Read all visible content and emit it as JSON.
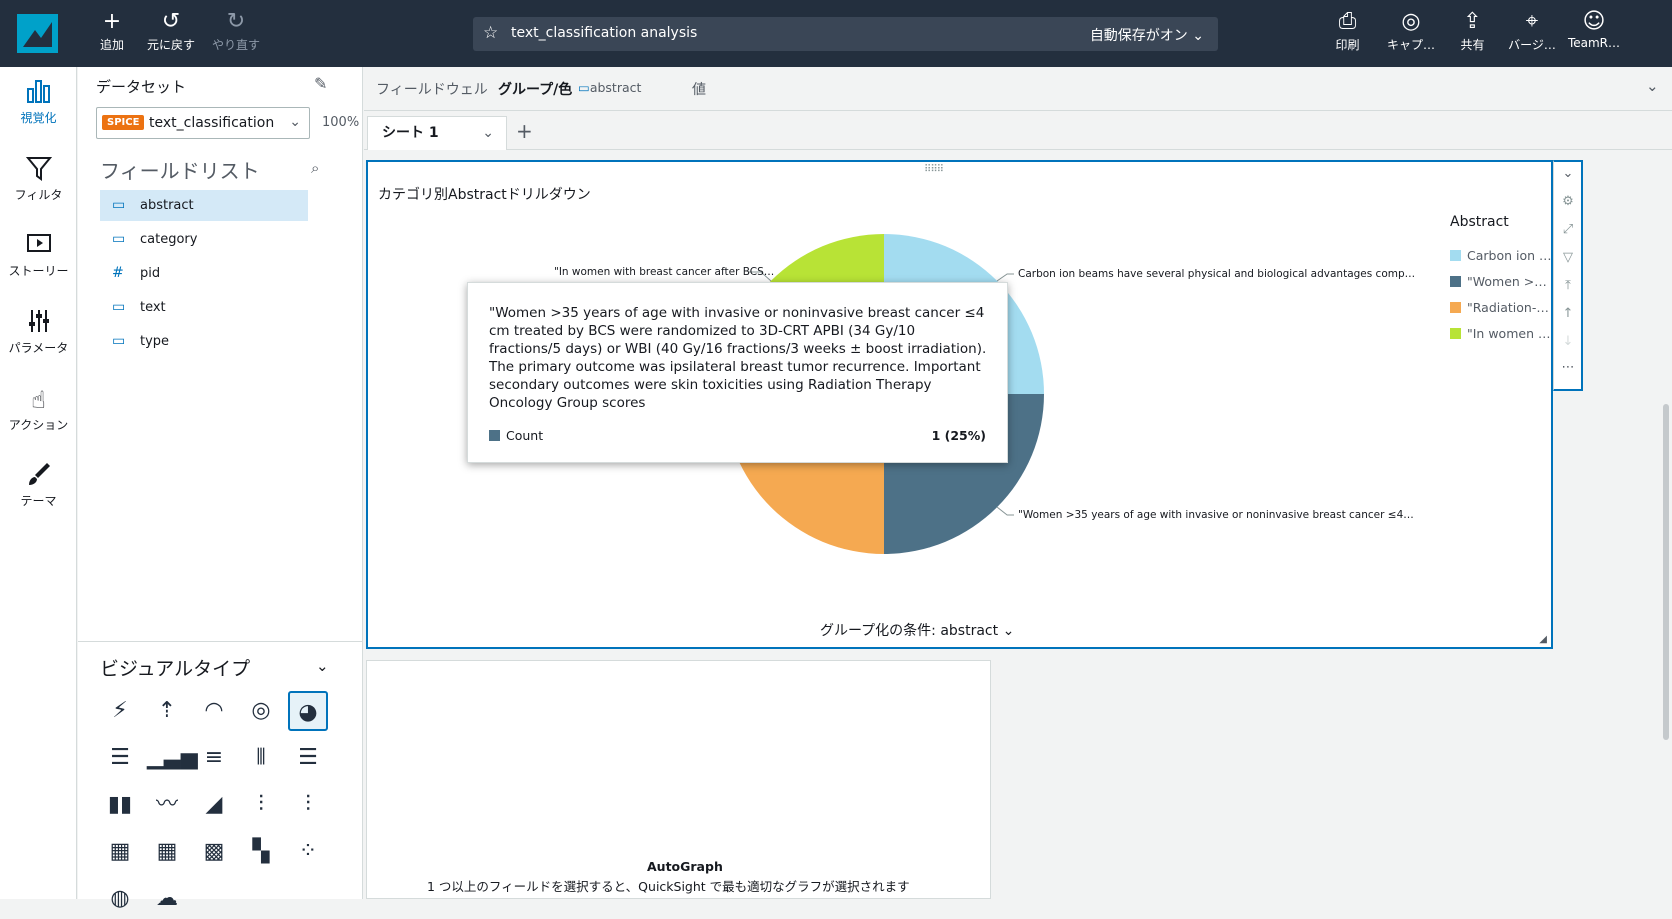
{
  "topbar": {
    "add": "追加",
    "undo": "元に戻す",
    "redo": "やり直す",
    "analysis_name": "text_classification analysis",
    "autosave": "自動保存がオン",
    "print": "印刷",
    "capture": "キャプ…",
    "share": "共有",
    "version": "バージ…",
    "user": "TeamR…"
  },
  "rail": {
    "visualize": "視覚化",
    "filter": "フィルタ",
    "story": "ストーリー",
    "parameters": "パラメータ",
    "actions": "アクション",
    "themes": "テーマ"
  },
  "dataset": {
    "label": "データセット",
    "badge": "SPICE",
    "name": "text_classification",
    "percent": "100%"
  },
  "field_list": {
    "title": "フィールドリスト",
    "fields": [
      {
        "type": "dimension",
        "name": "abstract"
      },
      {
        "type": "dimension",
        "name": "category"
      },
      {
        "type": "measure",
        "name": "pid"
      },
      {
        "type": "dimension",
        "name": "text"
      },
      {
        "type": "dimension",
        "name": "type"
      }
    ]
  },
  "visual_types": {
    "title": "ビジュアルタイプ"
  },
  "field_wells": {
    "label": "フィールドウェル",
    "group_label": "グループ/色",
    "group_value": "abstract",
    "value_label": "値"
  },
  "sheet": {
    "tab": "シート 1"
  },
  "visual": {
    "title": "カテゴリ別Abstractドリルダウン",
    "group_by": "グループ化の条件: abstract",
    "legend_title": "Abstract"
  },
  "chart_data": {
    "type": "pie",
    "title": "カテゴリ別Abstractドリルダウン",
    "legend_title": "Abstract",
    "slices": [
      {
        "label": "Carbon ion …",
        "full_label": "Carbon ion beams have several physical and biological advantages comp…",
        "value": 1,
        "color": "#a3dcf0"
      },
      {
        "label": "\"Women >…",
        "full_label": "\"Women >35 years of age with invasive or noninvasive breast cancer ≤4…",
        "value": 1,
        "color": "#4d7187"
      },
      {
        "label": "\"Radiation-…",
        "full_label": "",
        "value": 1,
        "color": "#f5a951"
      },
      {
        "label": "\"In women …",
        "full_label": "\"In women with breast cancer after BCS…",
        "value": 1,
        "color": "#b8e336"
      }
    ]
  },
  "tooltip": {
    "text": "\"Women >35 years of age with invasive or noninvasive breast cancer ≤4 cm treated by BCS were randomized to 3D-CRT APBI (34 Gy/10 fractions/5 days) or WBI (40 Gy/16 fractions/3 weeks ± boost irradiation). The primary outcome was ipsilateral breast tumor recurrence. Important secondary outcomes were skin toxicities using Radiation Therapy Oncology Group scores",
    "metric": "Count",
    "value": "1 (25%)"
  },
  "autograph": {
    "title": "AutoGraph",
    "desc": "1 つ以上のフィールドを選択すると、QuickSight で最も適切なグラフが選択されます"
  }
}
